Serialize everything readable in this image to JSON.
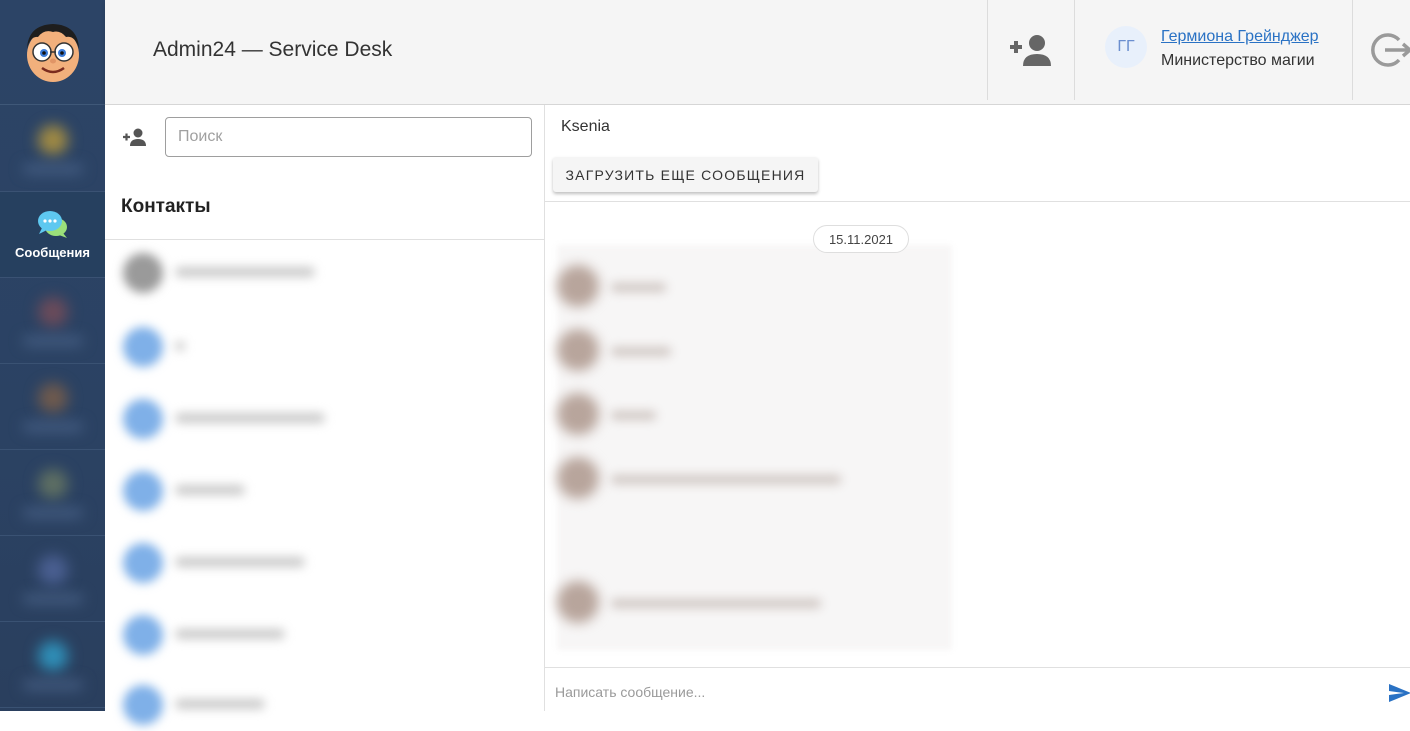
{
  "header": {
    "app_title": "Admin24 — Service Desk",
    "user_initials": "ГГ",
    "user_name": "Гермиона Грейнджер",
    "user_org": "Министерство магии"
  },
  "sidebar": {
    "items": [
      {
        "label": "",
        "icon": "dashboard-icon",
        "color": "#a08a43",
        "blurred": true
      },
      {
        "label": "Сообщения",
        "icon": "chat-bubbles-icon",
        "color": "#4fc3f7",
        "blurred": false
      },
      {
        "label": "",
        "icon": "section-icon",
        "color": "#6b4b5a",
        "blurred": true
      },
      {
        "label": "",
        "icon": "section-icon",
        "color": "#6f5a4d",
        "blurred": true
      },
      {
        "label": "",
        "icon": "section-icon",
        "color": "#5e6f63",
        "blurred": true
      },
      {
        "label": "",
        "icon": "section-icon",
        "color": "#4a5f91",
        "blurred": true
      },
      {
        "label": "",
        "icon": "section-icon",
        "color": "#2f8fb8",
        "blurred": true
      }
    ]
  },
  "contacts": {
    "search_placeholder": "Поиск",
    "search_value": "",
    "title": "Контакты",
    "items": [
      {
        "color": "#9a9a9a",
        "name_width": 140
      },
      {
        "color": "#7fb0e8",
        "name_width": 10
      },
      {
        "color": "#7fb0e8",
        "name_width": 150
      },
      {
        "color": "#7fb0e8",
        "name_width": 70
      },
      {
        "color": "#7fb0e8",
        "name_width": 130
      },
      {
        "color": "#7fb0e8",
        "name_width": 110
      },
      {
        "color": "#7fb0e8",
        "name_width": 90
      }
    ]
  },
  "chat": {
    "contact_name": "Ksenia",
    "load_more_label": "ЗАГРУЗИТЬ ЕЩЕ СООБЩЕНИЯ",
    "date_label": "15.11.2021",
    "composer_placeholder": "Написать сообщение...",
    "messages": [
      {
        "text_width": 55
      },
      {
        "text_width": 60
      },
      {
        "text_width": 45
      },
      {
        "text_width": 230
      },
      {
        "text_width": 210
      }
    ]
  },
  "colors": {
    "sidebar_bg": "#2b4263",
    "accent": "#2a72c4"
  }
}
